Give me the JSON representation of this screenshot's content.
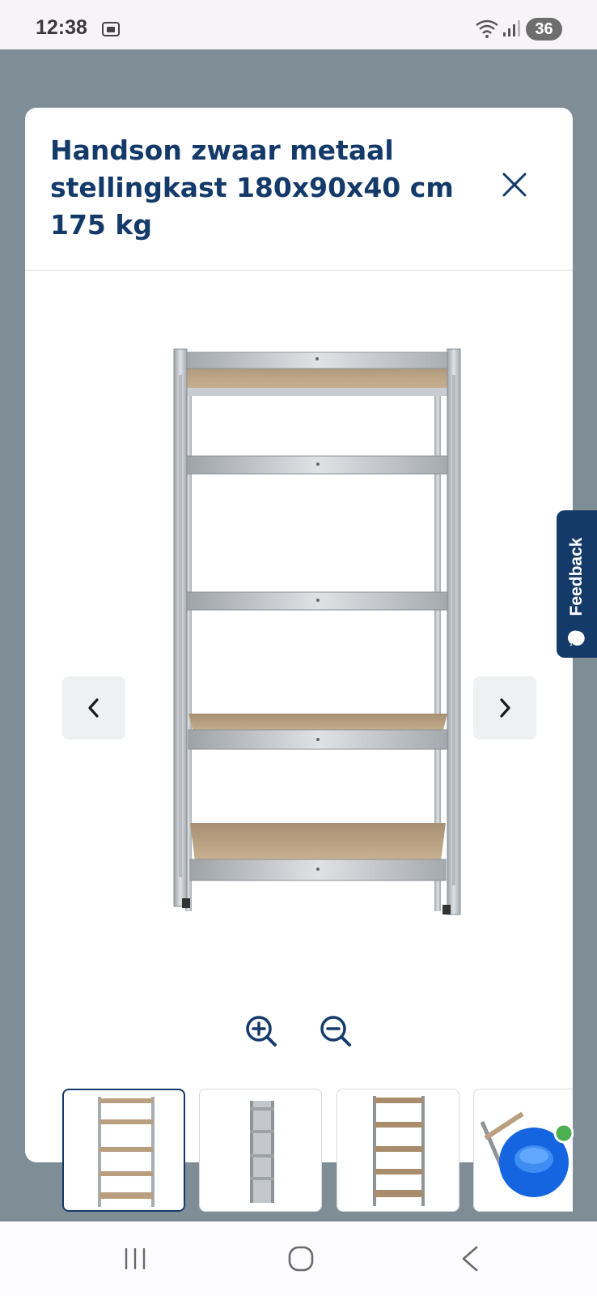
{
  "status_bar": {
    "time": "12:38",
    "battery": "36",
    "icons": [
      "screenshot-icon",
      "wifi-icon",
      "signal-icon"
    ]
  },
  "modal": {
    "title": "Handson zwaar metaal stellingkast 180x90x40 cm 175 kg",
    "close_icon": "close-icon",
    "prev_icon": "chevron-left-icon",
    "next_icon": "chevron-right-icon",
    "zoom_in_icon": "zoom-in-icon",
    "zoom_out_icon": "zoom-out-icon"
  },
  "thumbnails": {
    "selected_index": 0,
    "count_visible": 4
  },
  "feedback": {
    "label": "Feedback",
    "icon": "chat-bubble-icon"
  },
  "colors": {
    "brand_blue": "#143a6a",
    "backdrop": "#7f8e96",
    "fab_blue": "#1565e0",
    "online_dot": "#4caf50"
  },
  "nav_bar": {
    "icons": [
      "recent-apps-icon",
      "home-icon",
      "back-icon"
    ]
  }
}
